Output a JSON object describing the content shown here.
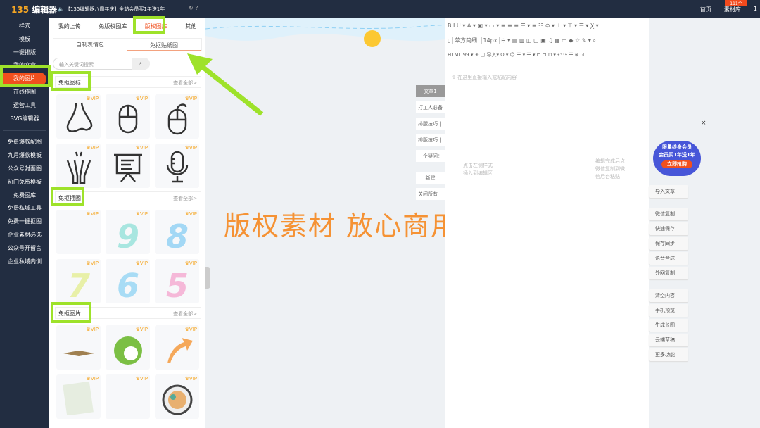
{
  "topbar": {
    "logo_num": "135",
    "logo_text": "编辑器",
    "notice": "【135编辑器八周年庆】全站会员买1年送1年",
    "links": [
      "首页",
      "素材库",
      "1"
    ],
    "badge": "111个"
  },
  "leftnav": {
    "items": [
      "样式",
      "模板",
      "一键排版",
      "我的文章",
      "我的图片",
      "在线作图",
      "运营工具",
      "SVG编辑器"
    ],
    "items2": [
      "免费爆款配图",
      "九月爆款模板",
      "公众号封面图",
      "热门免费模板",
      "免费图库",
      "免费私域工具",
      "免费一键抠图",
      "企业素材必选",
      "公众号开留言",
      "企业私域内训"
    ]
  },
  "panel": {
    "tabs": [
      "我的上传",
      "免版权图库",
      "版权图库",
      "其他"
    ],
    "subtabs": [
      "自制表情包",
      "免抠贴纸图"
    ],
    "search_placeholder": "输入关键词搜索",
    "sections": [
      {
        "title": "免抠图标",
        "more": "查看全部>"
      },
      {
        "title": "免抠插图",
        "more": "查看全部>"
      },
      {
        "title": "免抠图片",
        "more": "查看全部>"
      }
    ],
    "vip": "VIP"
  },
  "canvas": {
    "slogan": "版权素材  放心商用"
  },
  "articles": [
    "文章1",
    "打工人必备",
    "排版技巧 |",
    "排版技巧 |",
    "一个疑问：",
    "新建",
    "关闭所有"
  ],
  "editor": {
    "toolbar1": "B  I  U ▾  A ▾  ▣ ▾  ▭ ▾  ≡  ≡  ≡  ☰ ▾  ≡  ☷  ⊜ ▾  ⊥ ▾  ⊤ ▾  ☰ ▾  Ꭓ ▾",
    "font": "苹方简细",
    "size": "14px",
    "toolbar2": "⊖ ▾  ▤  ▥  ◫  ▢  ▣  ♫  ▦  ▭  ◆  ☆  ✎ ▾  ⌕",
    "toolbar3": "HTML  99 ▾  ⚭  ▢  导入▾  Ω ▾  ☺  ☰ ▾  ☰ ▾  ⊏  ⊐  ⊓ ▾  ↶  ↷  ☷  ⊗     ⊡",
    "hint_top": "⇧ 在这里直接输入或粘贴内容",
    "hint_left": "点击左侧样式\n插入到编辑区",
    "hint_right": "编辑完成后点\n微信复制到微\n信后台粘贴"
  },
  "promo": {
    "line1": "限量终身会员",
    "line2": "会员买1年送1年",
    "cta": "立即抢购"
  },
  "right_buttons": {
    "g1": [
      "导入文章"
    ],
    "g2": [
      "微信复制",
      "快速保存",
      "保存同步",
      "语音合成",
      "外网复制"
    ],
    "g3": [
      "清空内容",
      "手机预览",
      "生成长图",
      "云端草稿",
      "更多功能"
    ]
  },
  "colors": {
    "accent": "#f0501e",
    "highlight": "#9ee22a",
    "nav_bg": "#222d41",
    "slogan": "#f59234"
  }
}
